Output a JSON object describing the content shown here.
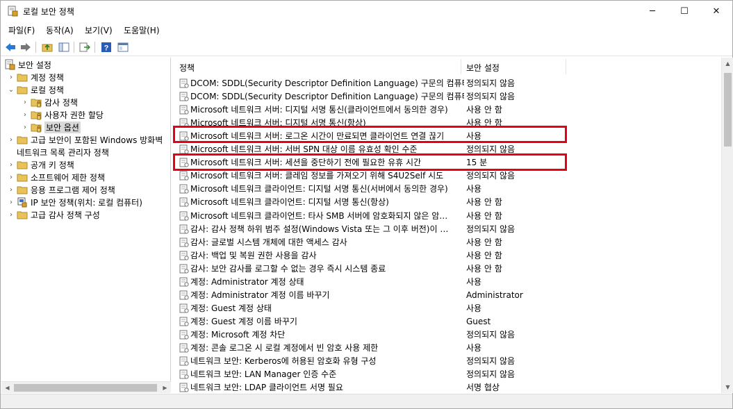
{
  "window": {
    "title": "로컬 보안 정책",
    "controls": {
      "minimize": "─",
      "maximize": "☐",
      "close": "✕"
    }
  },
  "menu": [
    "파일(F)",
    "동작(A)",
    "보기(V)",
    "도움말(H)"
  ],
  "tree": {
    "root": "보안 설정",
    "items": [
      {
        "label": "계정 정책",
        "expander": "›"
      },
      {
        "label": "로컬 정책",
        "expander": "⌄"
      },
      {
        "label": "감사 정책",
        "expander": "›"
      },
      {
        "label": "사용자 권한 할당",
        "expander": "›"
      },
      {
        "label": "보안 옵션",
        "expander": "›",
        "selected": true
      },
      {
        "label": "고급 보안이 포함된 Windows 방화벽",
        "expander": "›"
      },
      {
        "label": "네트워크 목록 관리자 정책",
        "expander": ""
      },
      {
        "label": "공개 키 정책",
        "expander": "›"
      },
      {
        "label": "소프트웨어 제한 정책",
        "expander": "›"
      },
      {
        "label": "응용 프로그램 제어 정책",
        "expander": "›"
      },
      {
        "label": "IP 보안 정책(위치: 로컬 컴퓨터)",
        "expander": "›"
      },
      {
        "label": "고급 감사 정책 구성",
        "expander": "›"
      }
    ]
  },
  "list": {
    "columns": {
      "policy": "정책",
      "setting": "보안 설정"
    },
    "sort_indicator": "^",
    "rows": [
      {
        "name": "DCOM: SDDL(Security Descriptor Definition Language) 구문의 컴퓨터…",
        "value": "정의되지 않음"
      },
      {
        "name": "DCOM: SDDL(Security Descriptor Definition Language) 구문의 컴퓨터…",
        "value": "정의되지 않음"
      },
      {
        "name": "Microsoft 네트워크 서버: 디지털 서명 통신(클라이언트에서 동의한 경우)",
        "value": "사용 안 함"
      },
      {
        "name": "Microsoft 네트워크 서버: 디지털 서명 통신(항상)",
        "value": "사용 안 함"
      },
      {
        "name": "Microsoft 네트워크 서버: 로그온 시간이 만료되면 클라이언트 연결 끊기",
        "value": "사용"
      },
      {
        "name": "Microsoft 네트워크 서버: 서버 SPN 대상 이름 유효성 확인 수준",
        "value": "정의되지 않음"
      },
      {
        "name": "Microsoft 네트워크 서버: 세션을 중단하기 전에 필요한 유휴 시간",
        "value": "15 분"
      },
      {
        "name": "Microsoft 네트워크 서버: 클레임 정보를 가져오기 위해 S4U2Self 시도",
        "value": "정의되지 않음"
      },
      {
        "name": "Microsoft 네트워크 클라이언트: 디지털 서명 통신(서버에서 동의한 경우)",
        "value": "사용"
      },
      {
        "name": "Microsoft 네트워크 클라이언트: 디지털 서명 통신(항상)",
        "value": "사용 안 함"
      },
      {
        "name": "Microsoft 네트워크 클라이언트: 타사 SMB 서버에 암호화되지 않은 암…",
        "value": "사용 안 함"
      },
      {
        "name": "감사: 감사 정책 하위 범주 설정(Windows Vista 또는 그 이후 버전)이 …",
        "value": "정의되지 않음"
      },
      {
        "name": "감사: 글로벌 시스템 개체에 대한 액세스 감사",
        "value": "사용 안 함"
      },
      {
        "name": "감사: 백업 및 복원 권한 사용을 감사",
        "value": "사용 안 함"
      },
      {
        "name": "감사: 보안 감사를 로그할 수 없는 경우 즉시 시스템 종료",
        "value": "사용 안 함"
      },
      {
        "name": "계정: Administrator 계정 상태",
        "value": "사용"
      },
      {
        "name": "계정: Administrator 계정 이름 바꾸기",
        "value": "Administrator"
      },
      {
        "name": "계정: Guest 계정 상태",
        "value": "사용"
      },
      {
        "name": "계정: Guest 계정 이름 바꾸기",
        "value": "Guest"
      },
      {
        "name": "계정: Microsoft 계정 차단",
        "value": "정의되지 않음"
      },
      {
        "name": "계정: 콘솔 로그온 시 로컬 계정에서 빈 암호 사용 제한",
        "value": "사용"
      },
      {
        "name": "네트워크 보안: Kerberos에 허용된 암호화 유형 구성",
        "value": "정의되지 않음"
      },
      {
        "name": "네트워크 보안: LAN Manager 인증 수준",
        "value": "정의되지 않음"
      },
      {
        "name": "네트워크 보안: LDAP 클라이언트 서명 필요",
        "value": "서명 협상"
      }
    ]
  },
  "highlight_color": "#e6001a"
}
